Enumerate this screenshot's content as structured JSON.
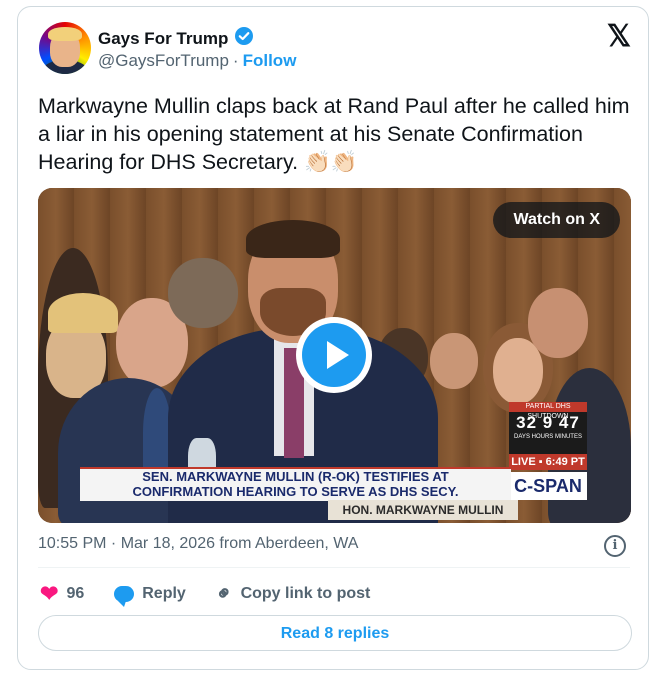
{
  "author": {
    "display_name": "Gays For Trump",
    "handle": "@GaysForTrump",
    "separator": "·",
    "follow_label": "Follow",
    "verified_color": "#1d9bf0"
  },
  "platform_logo": "𝕏",
  "tweet": {
    "text": "Markwayne Mullin claps back at Rand Paul after he called him a liar in his opening statement at his Senate Confirmation Hearing for DHS Secretary. 👏🏻👏🏻"
  },
  "video": {
    "watch_label": "Watch on X",
    "chyron_line1": "SEN. MARKWAYNE MULLIN (R-OK) TESTIFIES AT",
    "chyron_line2": "CONFIRMATION HEARING TO SERVE AS DHS SECY.",
    "nameplate": "HON. MARKWAYNE MULLIN",
    "shutdown_label": "PARTIAL DHS SHUTDOWN",
    "shutdown_counter": "32 9 47",
    "shutdown_units": "DAYS HOURS MINUTES",
    "live_label": "LIVE ▪ 6:49 PT",
    "network": "C-SPAN"
  },
  "meta": {
    "timestamp": "10:55 PM · Mar 18, 2026 from Aberdeen, WA"
  },
  "actions": {
    "like_count": "96",
    "reply_label": "Reply",
    "copy_label": "Copy link to post"
  },
  "read_replies_label": "Read 8 replies",
  "colors": {
    "accent": "#1d9bf0",
    "like": "#f91880",
    "text_secondary": "#536471"
  }
}
